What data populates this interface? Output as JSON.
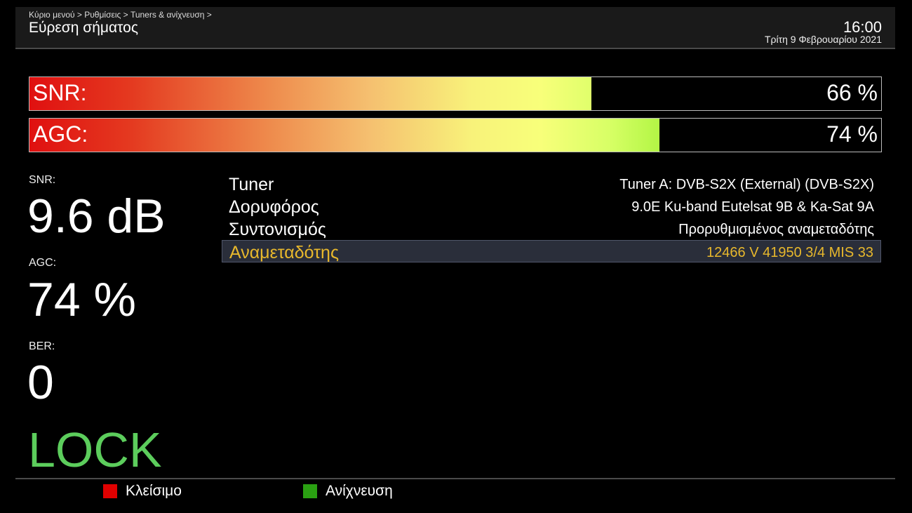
{
  "header": {
    "breadcrumb": "Κύριο μενού > Ρυθμίσεις > Tuners & ανίχνευση >",
    "title": "Εύρεση σήματος",
    "time": "16:00",
    "date": "Τρίτη  9 Φεβρουαρίου 2021"
  },
  "bars": {
    "snr": {
      "label": "SNR:",
      "percent_text": "66 %",
      "fraction": 0.66
    },
    "agc": {
      "label": "AGC:",
      "percent_text": "74 %",
      "fraction": 0.74
    }
  },
  "metrics": {
    "snr_label": "SNR:",
    "snr_value": "9.6 dB",
    "agc_label": "AGC:",
    "agc_value": "74 %",
    "ber_label": "BER:",
    "ber_value": "0",
    "lock_status": "LOCK"
  },
  "info": {
    "rows": [
      {
        "key": "Tuner",
        "value": "Tuner A: DVB-S2X (External) (DVB-S2X)"
      },
      {
        "key": "Δορυφόρος",
        "value": "9.0E Ku-band Eutelsat 9B & Ka-Sat 9A"
      },
      {
        "key": "Συντονισμός",
        "value": "Προρυθμισμένος αναμεταδότης"
      },
      {
        "key": "Αναμεταδότης",
        "value": "12466 V 41950 3/4 MIS 33"
      }
    ]
  },
  "footer": {
    "red_label": "Κλείσιμο",
    "green_label": "Ανίχνευση"
  },
  "colors": {
    "selected_text": "#e8b82c",
    "lock_green": "#5ccd5c",
    "red_key": "#e00000",
    "green_key": "#2aa012"
  }
}
